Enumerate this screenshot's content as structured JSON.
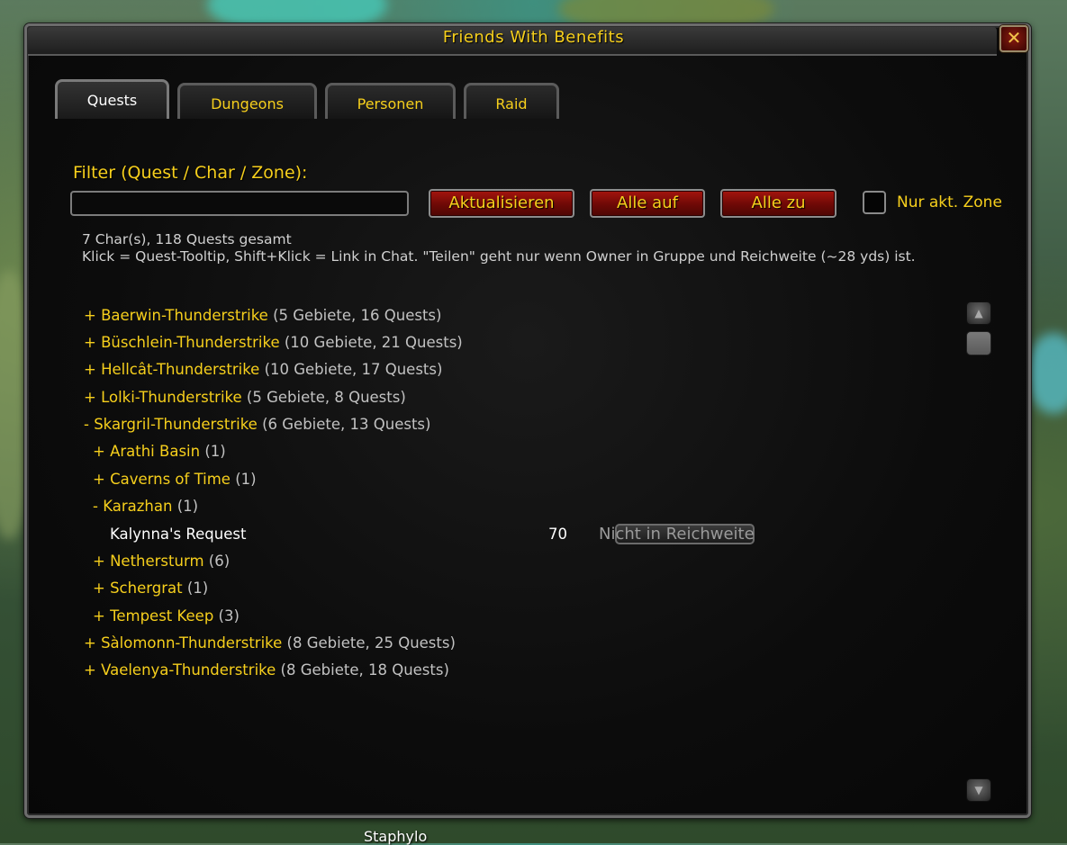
{
  "window": {
    "title": "Friends With Benefits",
    "close_label": "✕"
  },
  "tabs": [
    {
      "label": "Quests",
      "active": true
    },
    {
      "label": "Dungeons",
      "active": false
    },
    {
      "label": "Personen",
      "active": false
    },
    {
      "label": "Raid",
      "active": false
    }
  ],
  "filter": {
    "label": "Filter (Quest / Char / Zone):",
    "value": "",
    "placeholder": ""
  },
  "buttons": {
    "refresh": "Aktualisieren",
    "expand_all": "Alle auf",
    "collapse_all": "Alle zu"
  },
  "zone_filter": {
    "label": "Nur akt. Zone",
    "checked": false
  },
  "summary": {
    "line1": "7 Char(s), 118 Quests gesamt",
    "line2": "Klick = Quest-Tooltip,  Shift+Klick = Link in Chat. \"Teilen\" geht nur wenn Owner in Gruppe und Reichweite (~28 yds) ist."
  },
  "tree": [
    {
      "prefix": "+ ",
      "name": "Baerwin-Thunderstrike",
      "count": "(5 Gebiete, 16 Quests)"
    },
    {
      "prefix": "+ ",
      "name": "Büschlein-Thunderstrike",
      "count": "(10 Gebiete, 21 Quests)"
    },
    {
      "prefix": "+ ",
      "name": "Hellcât-Thunderstrike",
      "count": "(10 Gebiete, 17 Quests)"
    },
    {
      "prefix": "+ ",
      "name": "Lolki-Thunderstrike",
      "count": "(5 Gebiete, 8 Quests)"
    },
    {
      "prefix": "- ",
      "name": "Skargril-Thunderstrike",
      "count": "(6 Gebiete, 13 Quests)"
    },
    {
      "prefix": "+ ",
      "name": "Arathi Basin",
      "count": "(1)"
    },
    {
      "prefix": "+ ",
      "name": "Caverns of Time",
      "count": "(1)"
    },
    {
      "prefix": "- ",
      "name": "Karazhan",
      "count": "(1)"
    },
    {
      "prefix": "+ ",
      "name": "Nethersturm",
      "count": "(6)"
    },
    {
      "prefix": "+ ",
      "name": "Schergrat",
      "count": "(1)"
    },
    {
      "prefix": "+ ",
      "name": "Tempest Keep",
      "count": "(3)"
    },
    {
      "prefix": "+ ",
      "name": "Sàlomonn-Thunderstrike",
      "count": "(8 Gebiete, 25 Quests)"
    },
    {
      "prefix": "+ ",
      "name": "Vaelenya-Thunderstrike",
      "count": "(8 Gebiete, 18 Quests)"
    }
  ],
  "quest": {
    "title": "Kalynna's Request",
    "level": "70",
    "share_label": "Nicht in Reichweite"
  },
  "scrollbar": {
    "up_icon": "▲",
    "down_icon": "▼"
  },
  "nameplate": "Staphylo",
  "colors": {
    "gold": "#f6cf1c",
    "count_gray": "#c2c2c2",
    "button_red": "#a5150e"
  }
}
